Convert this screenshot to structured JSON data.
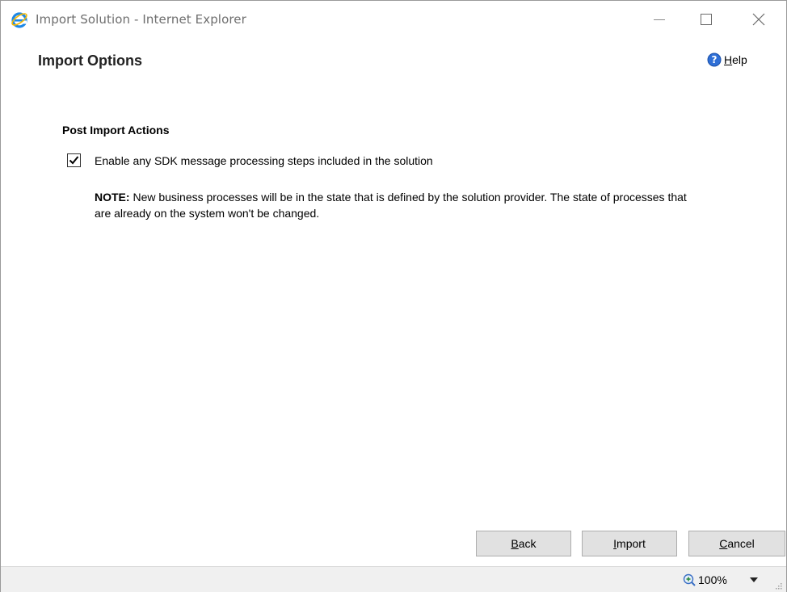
{
  "window": {
    "title": "Import Solution - Internet Explorer",
    "controls": {
      "minimize": "minimize",
      "maximize": "maximize",
      "close": "close"
    }
  },
  "header": {
    "title": "Import Options",
    "help": {
      "accel": "H",
      "rest": "elp",
      "icon": "help-icon"
    }
  },
  "content": {
    "section_title": "Post Import Actions",
    "option": {
      "checked": true,
      "label": "Enable any SDK message processing steps included in the solution"
    },
    "note": {
      "label": "NOTE:",
      "text": " New business processes will be in the state that is defined by the solution provider. The state of processes that are already on the system won't be changed."
    }
  },
  "footer": {
    "back": {
      "accel": "B",
      "rest": "ack"
    },
    "import": {
      "accel": "I",
      "rest": "mport"
    },
    "cancel": {
      "accel": "C",
      "rest": "ancel"
    }
  },
  "statusbar": {
    "zoom": "100%"
  },
  "colors": {
    "ie_blue": "#1e88e5",
    "help_blue": "#2f6fd6",
    "button_face": "#e1e1e1"
  }
}
